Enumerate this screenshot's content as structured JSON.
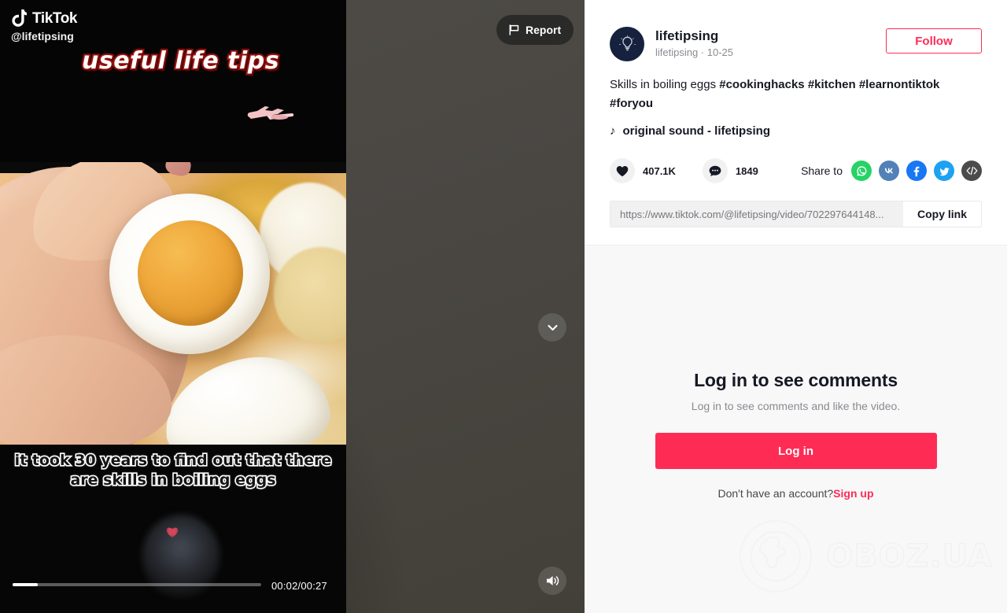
{
  "video": {
    "brand": "TikTok",
    "brand_handle": "@lifetipsing",
    "overlay_title": "useful life tips",
    "subtitle": "it took 30 years to find out that there are skills in boiling eggs",
    "time_display": "00:02/00:27",
    "progress_percent": 10,
    "report_label": "Report",
    "icons": {
      "tiktok_note": "tiktok-note-icon",
      "plane": "airplane-icon",
      "play": "play-icon",
      "flag": "flag-icon",
      "next": "chevron-down-icon",
      "volume": "volume-on-icon"
    }
  },
  "panel": {
    "author": {
      "name": "lifetipsing",
      "sub": "lifetipsing · 10-25",
      "avatar_icon": "lightbulb-icon",
      "avatar_bg": "#16213d"
    },
    "follow_label": "Follow",
    "description": {
      "text": "Skills in boiling eggs ",
      "tags": [
        "#cookinghacks",
        "#kitchen",
        "#learnontiktok",
        "#foryou"
      ]
    },
    "music": {
      "note_icon": "music-note-icon",
      "label": "original sound - lifetipsing"
    },
    "engagement": {
      "like": {
        "icon": "heart-icon",
        "count": "407.1K"
      },
      "comment": {
        "icon": "comment-icon",
        "count": "1849"
      }
    },
    "share": {
      "label": "Share to",
      "targets": [
        {
          "name": "whatsapp-icon",
          "color": "#25D366"
        },
        {
          "name": "vk-icon",
          "color": "#5181B8"
        },
        {
          "name": "facebook-icon",
          "color": "#1877F2"
        },
        {
          "name": "twitter-icon",
          "color": "#1DA1F2"
        },
        {
          "name": "embed-code-icon",
          "color": "#4b4b4b"
        }
      ]
    },
    "copy": {
      "url": "https://www.tiktok.com/@lifetipsing/video/702297644148...",
      "button_label": "Copy link"
    },
    "login": {
      "title": "Log in to see comments",
      "subtitle": "Log in to see comments and like the video.",
      "button_label": "Log in",
      "prompt": "Don't have an account?",
      "signup_label": "Sign up"
    }
  },
  "watermark": {
    "text": "OBOZ.UA",
    "icon": "globe-icon"
  },
  "colors": {
    "accent": "#fe2c55",
    "panel_bg": "#f8f8f8",
    "text": "#161823"
  }
}
